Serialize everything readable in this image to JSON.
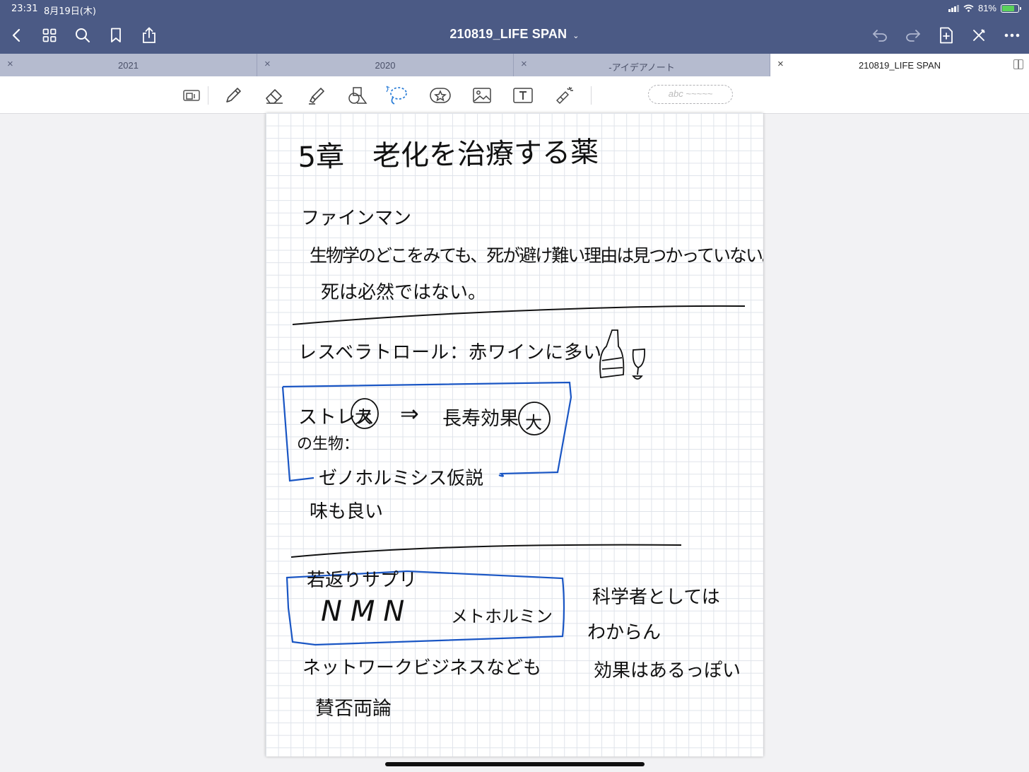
{
  "status_bar": {
    "time": "23:31",
    "date": "8月19日(木)",
    "battery_percent": "81%",
    "battery_level": 0.81
  },
  "header": {
    "title": "210819_LIFE SPAN"
  },
  "tabs": [
    {
      "label": "2021"
    },
    {
      "label": "2020"
    },
    {
      "label": "-アイデアノート"
    },
    {
      "label": "210819_LIFE SPAN",
      "active": true
    }
  ],
  "toolbar": {
    "handwriting_placeholder": "abc ~~~~~"
  },
  "note": {
    "title": "5章　老化を治療する薬",
    "section1": {
      "heading": "ファインマン",
      "line1": "生物学のどこをみても、死が避け難い理由は見つかっていない。",
      "line2": "死は必然ではない。"
    },
    "section2": {
      "resveratrol": "レスベラトロール：赤ワインに多い",
      "box_line1_left": "ストレス",
      "box_circle1": "大",
      "box_arrow": "⇒",
      "box_line1_right": "長寿効果",
      "box_circle2": "大",
      "box_line2": "の生物：",
      "box_line3": "ゼノホルミシス仮説",
      "after": "味も良い"
    },
    "section3": {
      "box_title": "若返りサプリ",
      "nmn": "NMN",
      "metformin": "メトホルミン",
      "right1": "科学者としては",
      "right2": "わからん",
      "right3": "効果はあるっぽい",
      "bottom1": "ネットワークビジネスなども",
      "bottom2": "賛否両論"
    }
  }
}
